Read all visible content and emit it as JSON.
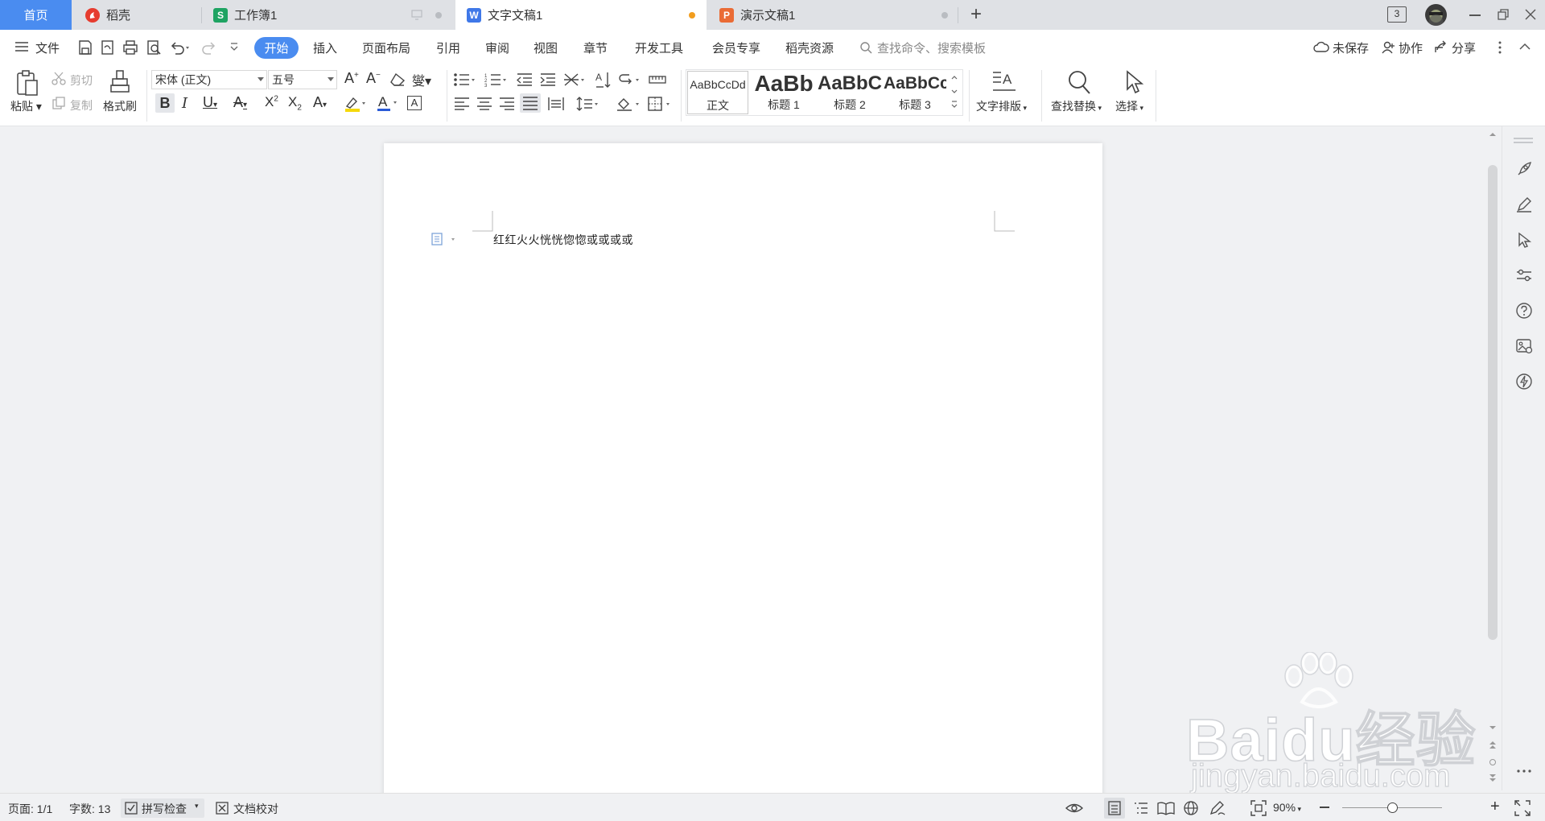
{
  "tabs": {
    "home": "首页",
    "items": [
      {
        "label": "稻壳",
        "badge_color": "#e63c2f"
      },
      {
        "label": "工作簿1",
        "badge_color": "#1ea362",
        "badge": "S"
      },
      {
        "label": "文字文稿1",
        "badge_color": "#3f78e8",
        "badge": "W",
        "active": true,
        "dot_color": "#f29d1e"
      },
      {
        "label": "演示文稿1",
        "badge_color": "#ea6b35",
        "badge": "P"
      }
    ],
    "add": "+",
    "window_count": "3"
  },
  "menu": {
    "file": "文件",
    "items": [
      "开始",
      "插入",
      "页面布局",
      "引用",
      "审阅",
      "视图",
      "章节",
      "开发工具",
      "会员专享",
      "稻壳资源"
    ],
    "search_placeholder": "查找命令、搜索模板",
    "unsaved": "未保存",
    "collaborate": "协作",
    "share": "分享"
  },
  "ribbon": {
    "paste": "粘贴",
    "cut": "剪切",
    "copy": "复制",
    "format_painter": "格式刷",
    "font_name": "宋体 (正文)",
    "font_size": "五号",
    "styles": [
      {
        "sample": "AaBbCcDd",
        "name": "正文"
      },
      {
        "sample": "AaBb",
        "name": "标题 1"
      },
      {
        "sample": "AaBbC",
        "name": "标题 2"
      },
      {
        "sample": "AaBbCc",
        "name": "标题 3"
      }
    ],
    "text_layout": "文字排版",
    "find_replace": "查找替换",
    "select": "选择"
  },
  "document": {
    "text": "红红火火恍恍惚惚或或或或"
  },
  "status": {
    "page": "页面: 1/1",
    "words": "字数: 13",
    "spell_check": "拼写检查",
    "proofread": "文档校对",
    "zoom": "90%",
    "zoom_level": 0.5
  },
  "watermark": {
    "brand": "Baidu经验",
    "url": "jingyan.baidu.com"
  },
  "colors": {
    "accent": "#4a8cf0",
    "tabbar": "#dfe1e5"
  }
}
